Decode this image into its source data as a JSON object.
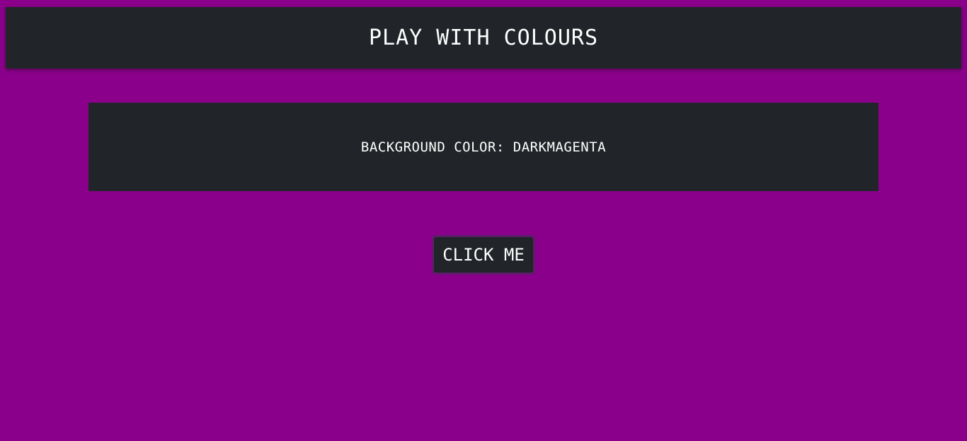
{
  "header": {
    "title": "PLAY WITH COLOURS"
  },
  "panel": {
    "text": "BACKGROUND COLOR: DARKMAGENTA"
  },
  "actions": {
    "button_label": "CLICK ME"
  },
  "colors": {
    "background": "#8b008b",
    "surface": "#212529",
    "text": "#ffffff",
    "button_border": "#5e1c6a"
  }
}
